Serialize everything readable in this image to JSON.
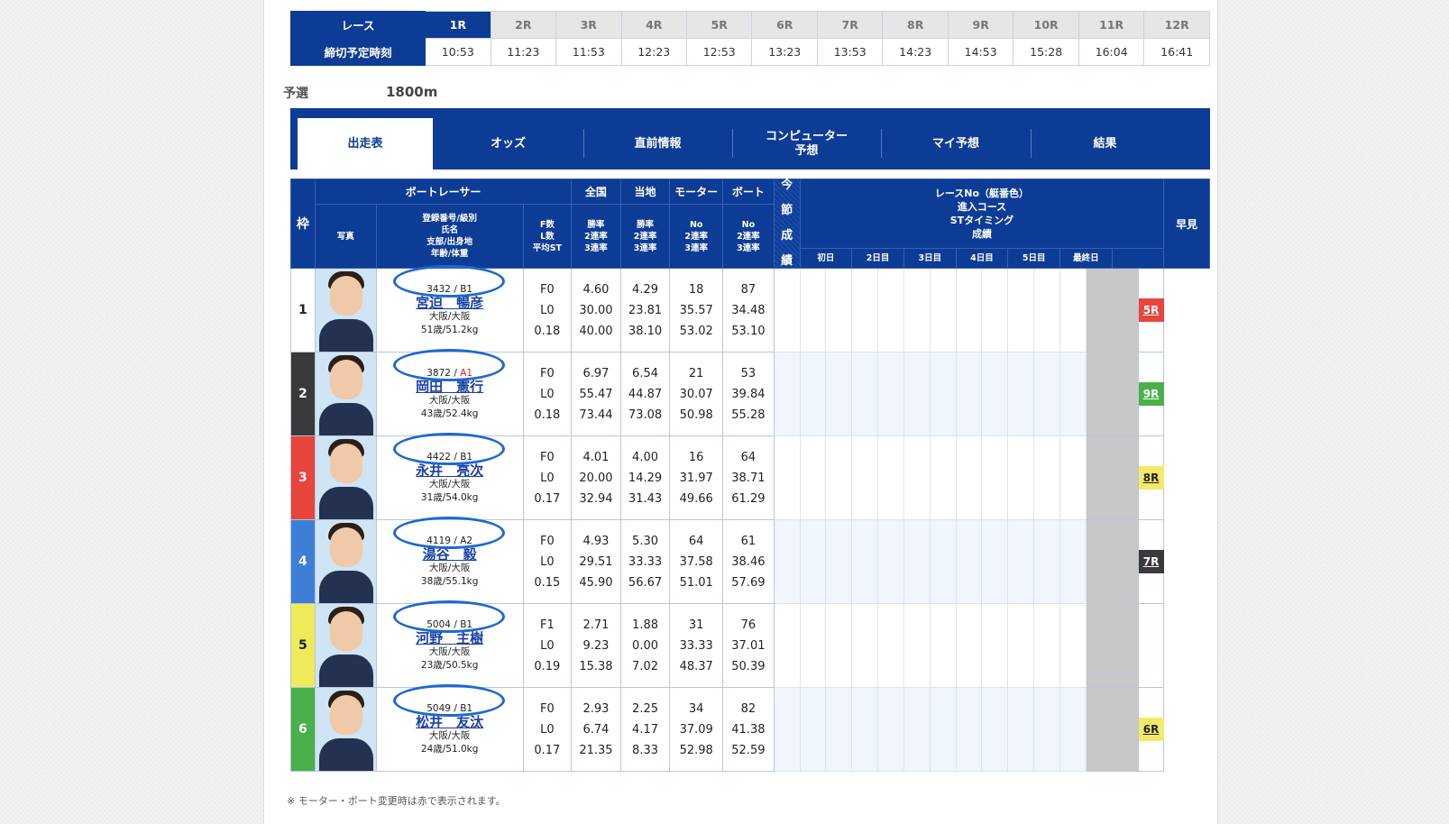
{
  "schedule": {
    "race_header": "レース",
    "deadline_header": "締切予定時刻",
    "races": [
      "1R",
      "2R",
      "3R",
      "4R",
      "5R",
      "6R",
      "7R",
      "8R",
      "9R",
      "10R",
      "11R",
      "12R"
    ],
    "times": [
      "10:53",
      "11:23",
      "11:53",
      "12:23",
      "12:53",
      "13:23",
      "13:53",
      "14:23",
      "14:53",
      "15:28",
      "16:04",
      "16:41"
    ],
    "active_index": 0
  },
  "race_meta": {
    "type": "予選",
    "distance": "1800m"
  },
  "tabs": [
    {
      "label": "出走表",
      "active": true
    },
    {
      "label": "オッズ"
    },
    {
      "label": "直前情報"
    },
    {
      "label": "コンピューター\n予想"
    },
    {
      "label": "マイ予想"
    },
    {
      "label": "結果"
    }
  ],
  "table_headers": {
    "waku": "枠",
    "boat_racer": "ボートレーサー",
    "photo": "写真",
    "racer_info": "登録番号/級別\n氏名\n支部/出身地\n年齢/体重",
    "fl_st": "F数\nL数\n平均ST",
    "national": "全国",
    "local": "当地",
    "motor": "モーター",
    "boat": "ボート",
    "rates": "勝率\n2連率\n3連率",
    "no_rates": "No\n2連率\n3連率",
    "imaseki": "今\n\n節\n\n成\n\n績",
    "series_title": "レースNo（艇番色）\n進入コース\nSTタイミング\n成績",
    "days": [
      "初日",
      "2日目",
      "3日目",
      "4日目",
      "5日目",
      "最終日"
    ],
    "hayami": "早見"
  },
  "racers": [
    {
      "waku": "1",
      "reg": "3432",
      "class": "B1",
      "name": "宮迫　暢彦",
      "branch": "大阪/大阪",
      "age_weight": "51歳/51.2kg",
      "f": "F0",
      "l": "L0",
      "st": "0.18",
      "nat": [
        "4.60",
        "30.00",
        "40.00"
      ],
      "loc": [
        "4.29",
        "23.81",
        "38.10"
      ],
      "motor": [
        "18",
        "35.57",
        "53.02"
      ],
      "boat": [
        "87",
        "34.48",
        "53.10"
      ],
      "hayami": "5R",
      "hayami_color": "#e8453c",
      "hayami_text": "#ffffff"
    },
    {
      "waku": "2",
      "reg": "3872",
      "class": "A1",
      "name": "岡田　憲行",
      "branch": "大阪/大阪",
      "age_weight": "43歳/52.4kg",
      "f": "F0",
      "l": "L0",
      "st": "0.18",
      "nat": [
        "6.97",
        "55.47",
        "73.44"
      ],
      "loc": [
        "6.54",
        "44.87",
        "73.08"
      ],
      "motor": [
        "21",
        "30.07",
        "50.98"
      ],
      "boat": [
        "53",
        "39.84",
        "55.28"
      ],
      "hayami": "9R",
      "hayami_color": "#4ab04a",
      "hayami_text": "#ffffff"
    },
    {
      "waku": "3",
      "reg": "4422",
      "class": "B1",
      "name": "永井　亮次",
      "branch": "大阪/大阪",
      "age_weight": "31歳/54.0kg",
      "f": "F0",
      "l": "L0",
      "st": "0.17",
      "nat": [
        "4.01",
        "20.00",
        "32.94"
      ],
      "loc": [
        "4.00",
        "14.29",
        "31.43"
      ],
      "motor": [
        "16",
        "31.97",
        "49.66"
      ],
      "boat": [
        "64",
        "38.71",
        "61.29"
      ],
      "hayami": "8R",
      "hayami_color": "#f2ea6a",
      "hayami_text": "#222222"
    },
    {
      "waku": "4",
      "reg": "4119",
      "class": "A2",
      "name": "湯谷　毅",
      "branch": "大阪/大阪",
      "age_weight": "38歳/55.1kg",
      "f": "F0",
      "l": "L0",
      "st": "0.15",
      "nat": [
        "4.93",
        "29.51",
        "45.90"
      ],
      "loc": [
        "5.30",
        "33.33",
        "56.67"
      ],
      "motor": [
        "64",
        "37.58",
        "51.01"
      ],
      "boat": [
        "61",
        "38.46",
        "57.69"
      ],
      "hayami": "7R",
      "hayami_color": "#3a3a3a",
      "hayami_text": "#ffffff"
    },
    {
      "waku": "5",
      "reg": "5004",
      "class": "B1",
      "name": "河野　主樹",
      "branch": "大阪/大阪",
      "age_weight": "23歳/50.5kg",
      "f": "F1",
      "l": "L0",
      "st": "0.19",
      "nat": [
        "2.71",
        "9.23",
        "15.38"
      ],
      "loc": [
        "1.88",
        "0.00",
        "7.02"
      ],
      "motor": [
        "31",
        "33.33",
        "48.37"
      ],
      "boat": [
        "76",
        "37.01",
        "50.39"
      ],
      "hayami": "",
      "hayami_color": "",
      "hayami_text": ""
    },
    {
      "waku": "6",
      "reg": "5049",
      "class": "B1",
      "name": "松井　友汰",
      "branch": "大阪/大阪",
      "age_weight": "24歳/51.0kg",
      "f": "F0",
      "l": "L0",
      "st": "0.17",
      "nat": [
        "2.93",
        "6.74",
        "21.35"
      ],
      "loc": [
        "2.25",
        "4.17",
        "8.33"
      ],
      "motor": [
        "34",
        "37.09",
        "52.98"
      ],
      "boat": [
        "82",
        "41.38",
        "52.59"
      ],
      "hayami": "6R",
      "hayami_color": "#f2ea6a",
      "hayami_text": "#222222"
    }
  ],
  "waku_colors": [
    "#ffffff",
    "#3a3a3a",
    "#e8453c",
    "#3d7fd6",
    "#eeea5a",
    "#4ab04a"
  ],
  "waku_text": [
    "#222222",
    "#ffffff",
    "#ffffff",
    "#ffffff",
    "#222222",
    "#ffffff"
  ],
  "footnote": "※ モーター・ボート変更時は赤で表示されます。"
}
